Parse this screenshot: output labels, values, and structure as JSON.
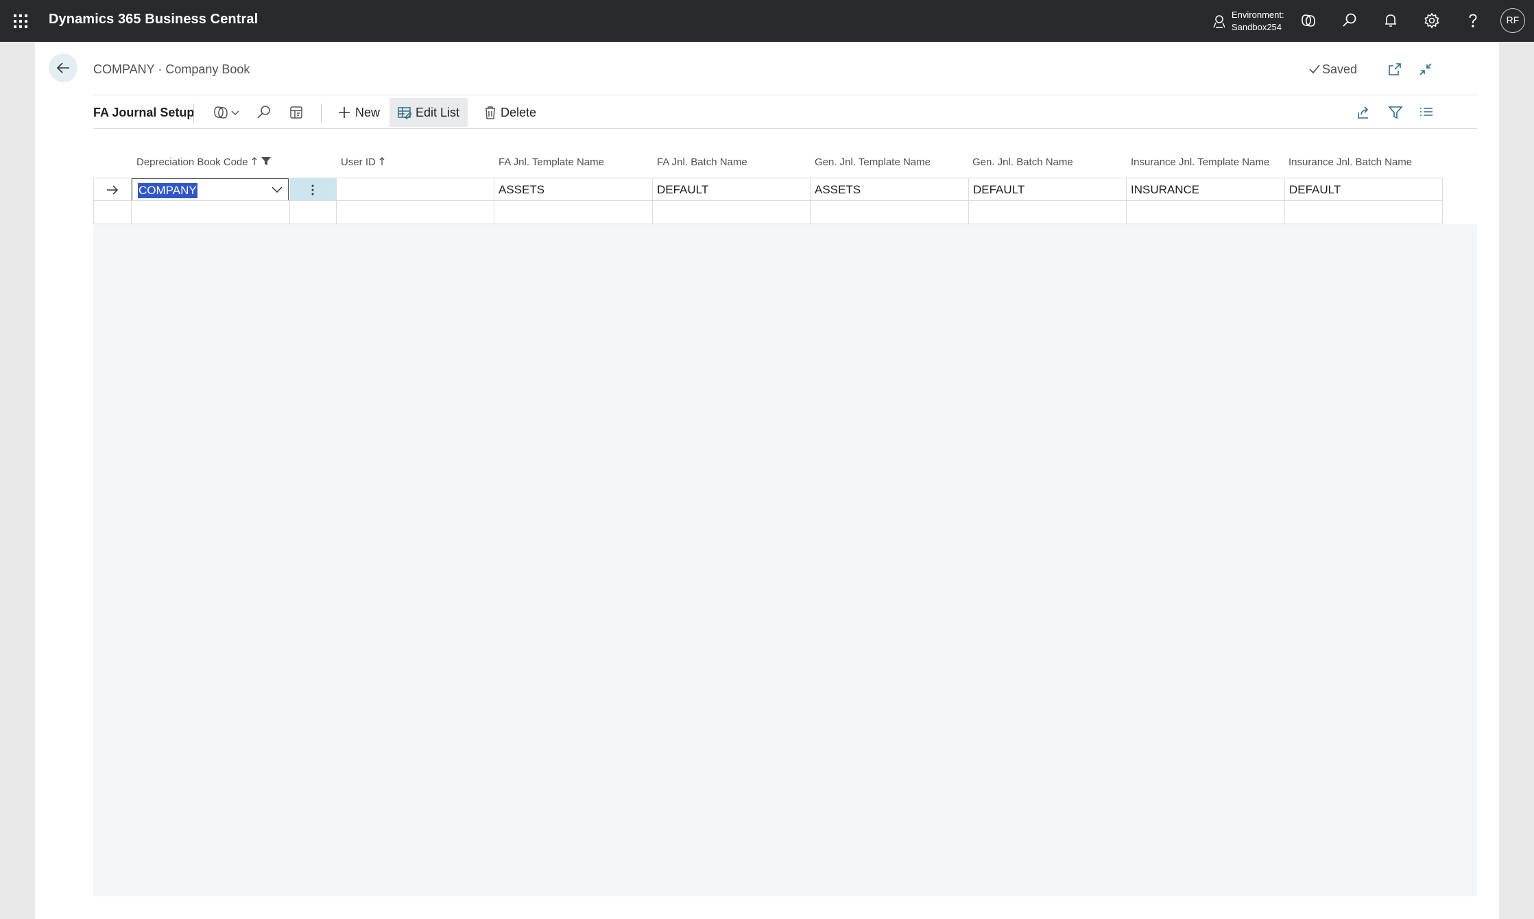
{
  "app": {
    "title": "Dynamics 365 Business Central",
    "environment_label": "Environment:",
    "environment_value": "Sandbox254",
    "user_initials": "RF"
  },
  "header": {
    "breadcrumb": "COMPANY · Company Book",
    "saved_label": "Saved"
  },
  "actionbar": {
    "page_name": "FA Journal Setup",
    "new_label": "New",
    "edit_list_label": "Edit List",
    "delete_label": "Delete"
  },
  "grid": {
    "columns": [
      "Depreciation Book Code",
      "User ID",
      "FA Jnl. Template Name",
      "FA Jnl. Batch Name",
      "Gen. Jnl. Template Name",
      "Gen. Jnl. Batch Name",
      "Insurance Jnl. Template Name",
      "Insurance Jnl. Batch Name"
    ],
    "rows": [
      {
        "depreciation_book_code": "COMPANY",
        "user_id": "",
        "fa_jnl_template_name": "ASSETS",
        "fa_jnl_batch_name": "DEFAULT",
        "gen_jnl_template_name": "ASSETS",
        "gen_jnl_batch_name": "DEFAULT",
        "insurance_jnl_template_name": "INSURANCE",
        "insurance_jnl_batch_name": "DEFAULT"
      },
      {
        "depreciation_book_code": "",
        "user_id": "",
        "fa_jnl_template_name": "",
        "fa_jnl_batch_name": "",
        "gen_jnl_template_name": "",
        "gen_jnl_batch_name": "",
        "insurance_jnl_template_name": "",
        "insurance_jnl_batch_name": ""
      }
    ]
  },
  "colors": {
    "app_bar": "#282a2c",
    "selection": "#2f57c7",
    "active_cell": "#cde6ee"
  }
}
